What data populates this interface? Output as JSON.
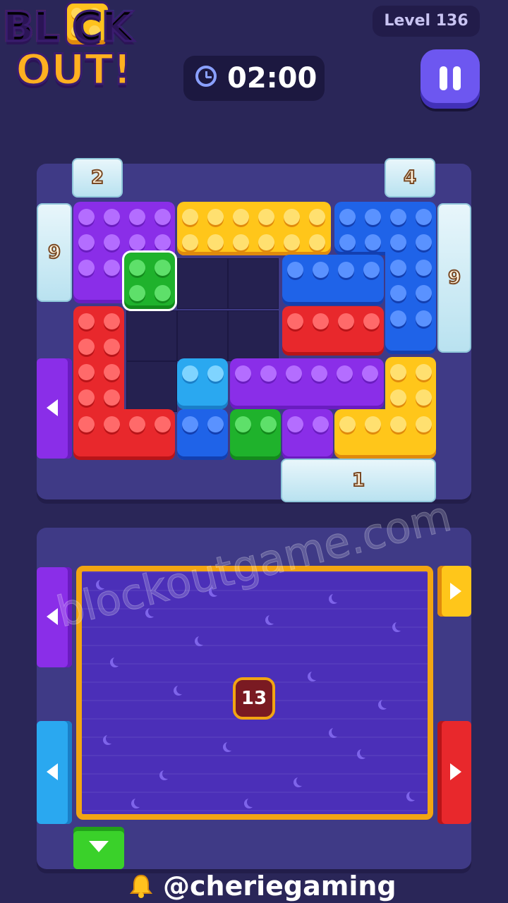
{
  "logo": {
    "line1": "BL CK",
    "line2": "OUT!"
  },
  "level_label": "Level 136",
  "timer": {
    "icon": "clock-icon",
    "value": "02:00"
  },
  "pause": {
    "icon": "pause-icon"
  },
  "colors": {
    "red": "#e8282c",
    "yellow": "#ffc61a",
    "blue": "#1f63e8",
    "purple": "#8a2ee8",
    "green": "#1fb22c",
    "cyan": "#2aa8f0",
    "gate_ice": "#d6eef7",
    "tray_border": "#f2a512"
  },
  "top_board": {
    "gates": {
      "top_left": "2",
      "top_right": "4",
      "left": "9",
      "right": "9",
      "bottom": "1"
    },
    "pieces": [
      {
        "name": "purple-block-top-left",
        "color": "purple"
      },
      {
        "name": "yellow-block-top",
        "color": "yellow"
      },
      {
        "name": "blue-block-top-right",
        "color": "blue"
      },
      {
        "name": "green-block-selected",
        "color": "green"
      },
      {
        "name": "blue-block-middle",
        "color": "blue"
      },
      {
        "name": "red-block-middle",
        "color": "red"
      },
      {
        "name": "red-block-l-shape",
        "color": "red"
      },
      {
        "name": "cyan-block-small",
        "color": "cyan"
      },
      {
        "name": "purple-block-bar",
        "color": "purple"
      },
      {
        "name": "yellow-block-bottom-right",
        "color": "yellow"
      },
      {
        "name": "blue-block-bottom",
        "color": "blue"
      },
      {
        "name": "green-block-bottom",
        "color": "green"
      },
      {
        "name": "purple-block-bottom",
        "color": "purple"
      }
    ]
  },
  "bottom_board": {
    "remaining": "13"
  },
  "watermark": "blockoutgame.com",
  "footer": {
    "icon": "bell-icon",
    "handle": "@cheriegaming"
  }
}
